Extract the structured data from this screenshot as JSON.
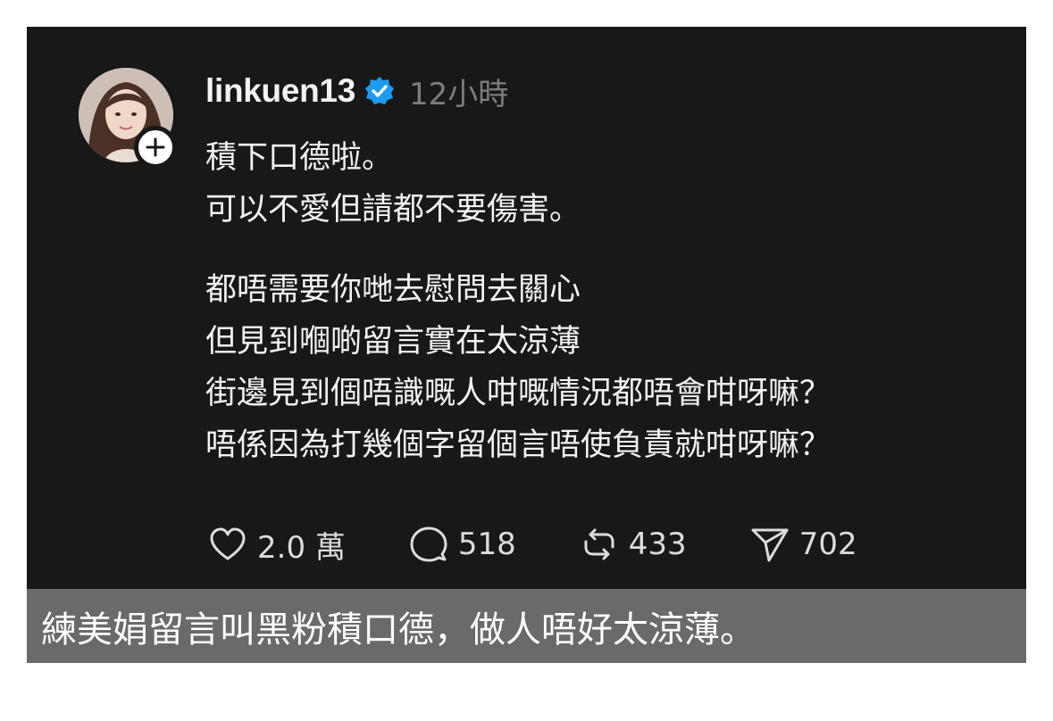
{
  "post": {
    "username": "linkuen13",
    "verified_icon": "verified-badge-icon",
    "timestamp": "12小時",
    "lines": [
      "積下口德啦。",
      "可以不愛但請都不要傷害。",
      "都唔需要你哋去慰問去關心",
      "但見到嗰啲留言實在太涼薄",
      "街邊見到個唔識嘅人咁嘅情況都唔會咁呀嘛？",
      "唔係因為打幾個字留個言唔使負責就咁呀嘛？"
    ],
    "actions": {
      "like_count": "2.0 萬",
      "comment_count": "518",
      "repost_count": "433",
      "share_count": "702"
    }
  },
  "caption": "練美娟留言叫黑粉積口德，做人唔好太涼薄。",
  "colors": {
    "background": "#181818",
    "verified": "#1d9bf0",
    "caption_bg": "#6a6a6a"
  }
}
